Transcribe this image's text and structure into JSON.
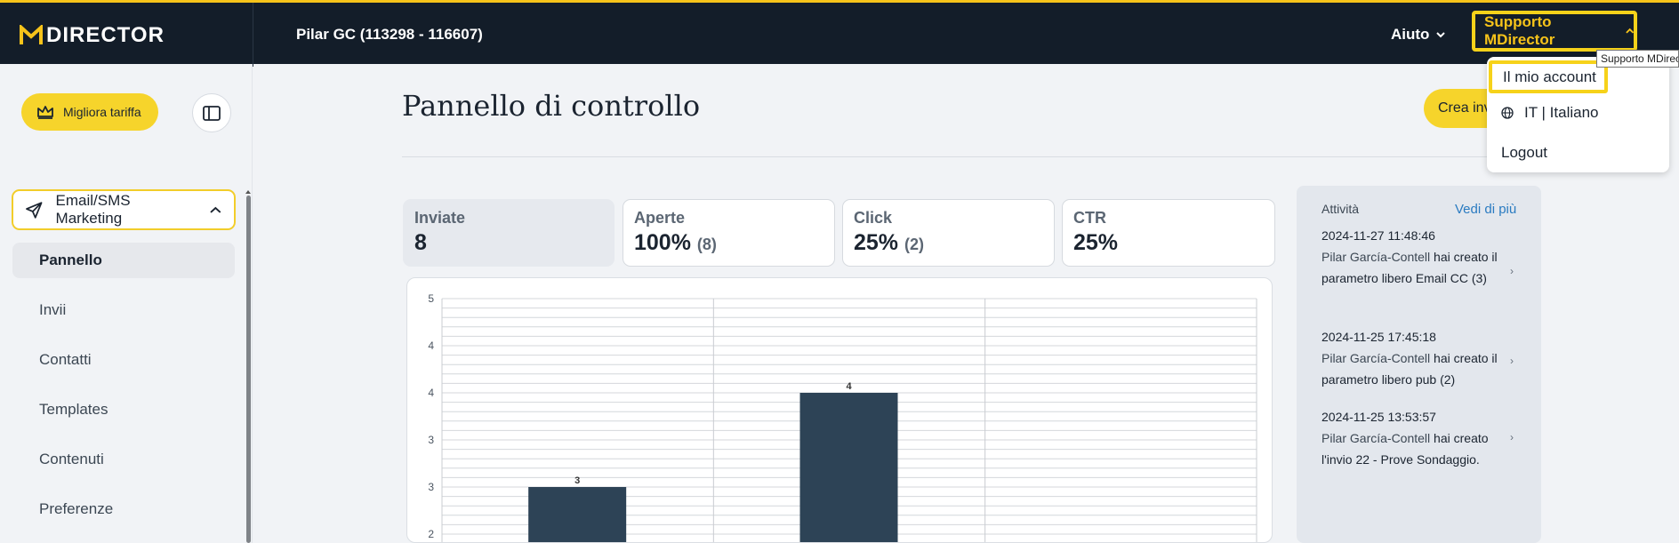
{
  "header": {
    "logo_text": "DIRECTOR",
    "account_name": "Pilar GC (113298 - 116607)",
    "help_label": "Aiuto",
    "support_label": "Supporto MDirector",
    "tooltip": "Supporto MDirector"
  },
  "dropdown": {
    "items": [
      "Il mio account",
      "IT | Italiano",
      "Logout"
    ]
  },
  "sidebar": {
    "upgrade_label": "Migliora tariffa",
    "section_label": "Email/SMS Marketing",
    "items": [
      "Pannello",
      "Invii",
      "Contatti",
      "Templates",
      "Contenuti",
      "Preferenze"
    ],
    "active_item": "Pannello"
  },
  "main": {
    "title": "Pannello di controllo",
    "create_label": "Crea invio"
  },
  "stats": [
    {
      "label": "Inviate",
      "value": "8",
      "sub": ""
    },
    {
      "label": "Aperte",
      "value": "100%",
      "sub": "(8)"
    },
    {
      "label": "Click",
      "value": "25%",
      "sub": "(2)"
    },
    {
      "label": "CTR",
      "value": "25%",
      "sub": ""
    }
  ],
  "chart_data": {
    "type": "bar",
    "categories": [
      "",
      "",
      ""
    ],
    "values": [
      3,
      4,
      null
    ],
    "data_labels": [
      "3",
      "4",
      ""
    ],
    "y_tick_labels": [
      "5",
      "4",
      "4",
      "3",
      "3",
      "2"
    ],
    "ylim": [
      1.5,
      5
    ],
    "grid": true,
    "bar_color": "#2d4356"
  },
  "activity": {
    "title": "Attività",
    "see_more": "Vedi di più",
    "items": [
      {
        "date": "2024-11-27 11:48:46",
        "user": "Pilar García-Contell",
        "text": "hai creato il parametro libero Email CC (3)"
      },
      {
        "date": "2024-11-25 17:45:18",
        "user": "Pilar García-Contell",
        "text": "hai creato il parametro libero pub (2)"
      },
      {
        "date": "2024-11-25 13:53:57",
        "user": "Pilar García-Contell",
        "text": "hai creato l'invio 22 - Prove Sondaggio."
      }
    ]
  },
  "colors": {
    "accent": "#f6d21a",
    "topbar": "#131d29",
    "bar": "#2d4356",
    "link": "#2a7bc1"
  }
}
